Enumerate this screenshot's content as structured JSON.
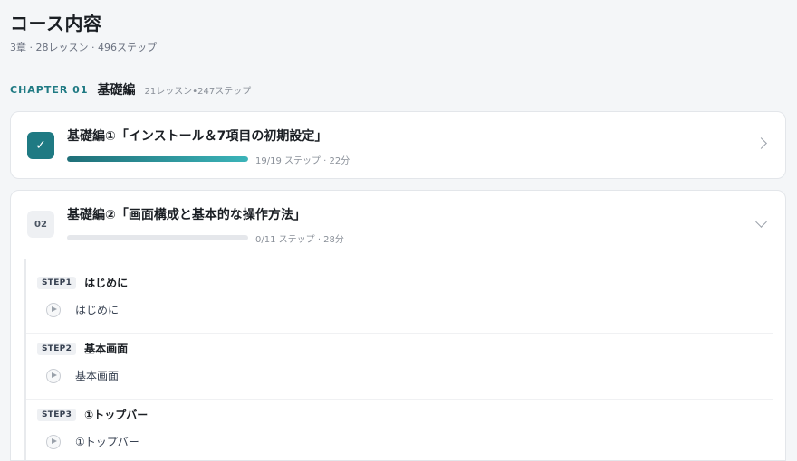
{
  "page": {
    "title": "コース内容",
    "subtitle": "3章 · 28レッスン · 496ステップ"
  },
  "chapter": {
    "label": "CHAPTER 01",
    "title": "基礎編",
    "meta": "21レッスン•247ステップ"
  },
  "lessons": [
    {
      "badge": "✓",
      "title": "基礎編①「インストール＆7項目の初期設定」",
      "progress": 1.0,
      "meta": "19/19 ステップ · 22分",
      "state": "completed",
      "chevron": "chevron-right-icon"
    },
    {
      "badge": "02",
      "title": "基礎編②「画面構成と基本的な操作方法」",
      "progress": 0.0,
      "meta": "0/11 ステップ · 28分",
      "state": "expanded",
      "chevron": "chevron-down-icon",
      "steps": [
        {
          "badge": "STEP1",
          "title": "はじめに",
          "item": "はじめに"
        },
        {
          "badge": "STEP2",
          "title": "基本画面",
          "item": "基本画面"
        },
        {
          "badge": "STEP3",
          "title": "①トップバー",
          "item": "①トップバー"
        }
      ]
    }
  ],
  "colors": {
    "accent": "#1f7a83",
    "background": "#f4f6f8"
  }
}
